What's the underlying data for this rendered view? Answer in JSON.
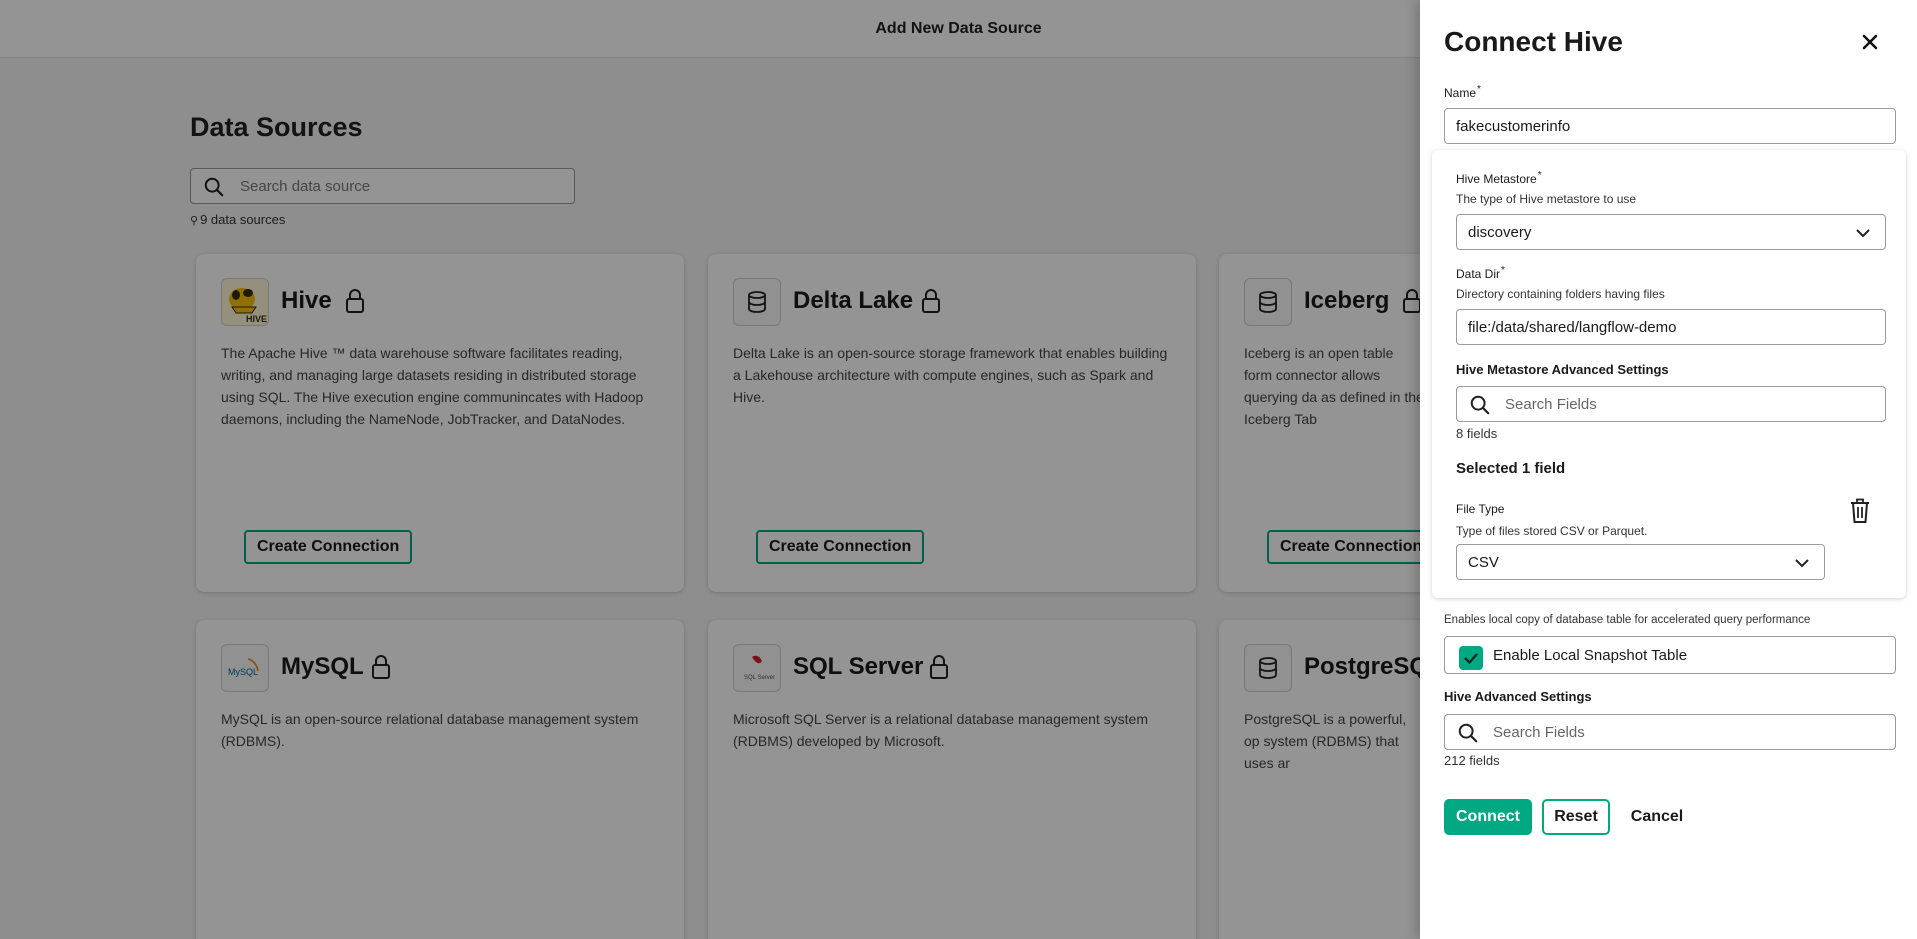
{
  "topbar": {
    "title": "Add New Data Source"
  },
  "page": {
    "title": "Data Sources",
    "search_placeholder": "Search data source",
    "count_text": "9 data sources"
  },
  "cards": [
    {
      "name": "Hive",
      "description": "The Apache Hive ™ data warehouse software facilitates reading, writing, and managing large datasets residing in distributed storage using SQL. The Hive execution engine communincates with Hadoop daemons, including the NameNode, JobTracker, and DataNodes.",
      "button": "Create Connection",
      "logo_text": "HIVE"
    },
    {
      "name": "Delta Lake",
      "description": "Delta Lake is an open-source storage framework that enables building a Lakehouse architecture with compute engines, such as Spark and Hive.",
      "button": "Create Connection"
    },
    {
      "name": "Iceberg",
      "description": "Iceberg is an open table form connector allows querying da as defined in the Iceberg Tab",
      "button": "Create Connection"
    },
    {
      "name": "MySQL",
      "description": "MySQL is an open-source relational database management system (RDBMS).",
      "logo_text": "MySQL"
    },
    {
      "name": "SQL Server",
      "description": "Microsoft SQL Server is a relational database management system (RDBMS) developed by Microsoft.",
      "logo_text": "SQL Server"
    },
    {
      "name": "PostgreSQ",
      "description": "PostgreSQL is a powerful, op system (RDBMS) that uses ar"
    }
  ],
  "panel": {
    "title": "Connect Hive",
    "name_label": "Name",
    "name_value": "fakecustomerinfo",
    "metastore_label": "Hive Metastore",
    "metastore_hint": "The type of Hive metastore to use",
    "metastore_value": "discovery",
    "datadir_label": "Data Dir",
    "datadir_hint": "Directory containing folders having files",
    "datadir_value": "file:/data/shared/langflow-demo",
    "meta_adv_label": "Hive Metastore Advanced Settings",
    "meta_adv_search_placeholder": "Search Fields",
    "meta_adv_count": "8 fields",
    "selected_text": "Selected 1 field",
    "filetype_label": "File Type",
    "filetype_hint": "Type of files stored CSV or Parquet.",
    "filetype_value": "CSV",
    "snapshot_hint": "Enables local copy of database table for accelerated query performance",
    "snapshot_label": "Enable Local Snapshot Table",
    "snapshot_checked": true,
    "hive_adv_label": "Hive Advanced Settings",
    "hive_adv_search_placeholder": "Search Fields",
    "hive_adv_count": "212 fields",
    "connect_label": "Connect",
    "reset_label": "Reset",
    "cancel_label": "Cancel"
  },
  "colors": {
    "accent": "#01a982",
    "overlay": "rgba(0,0,0,0.42)"
  }
}
